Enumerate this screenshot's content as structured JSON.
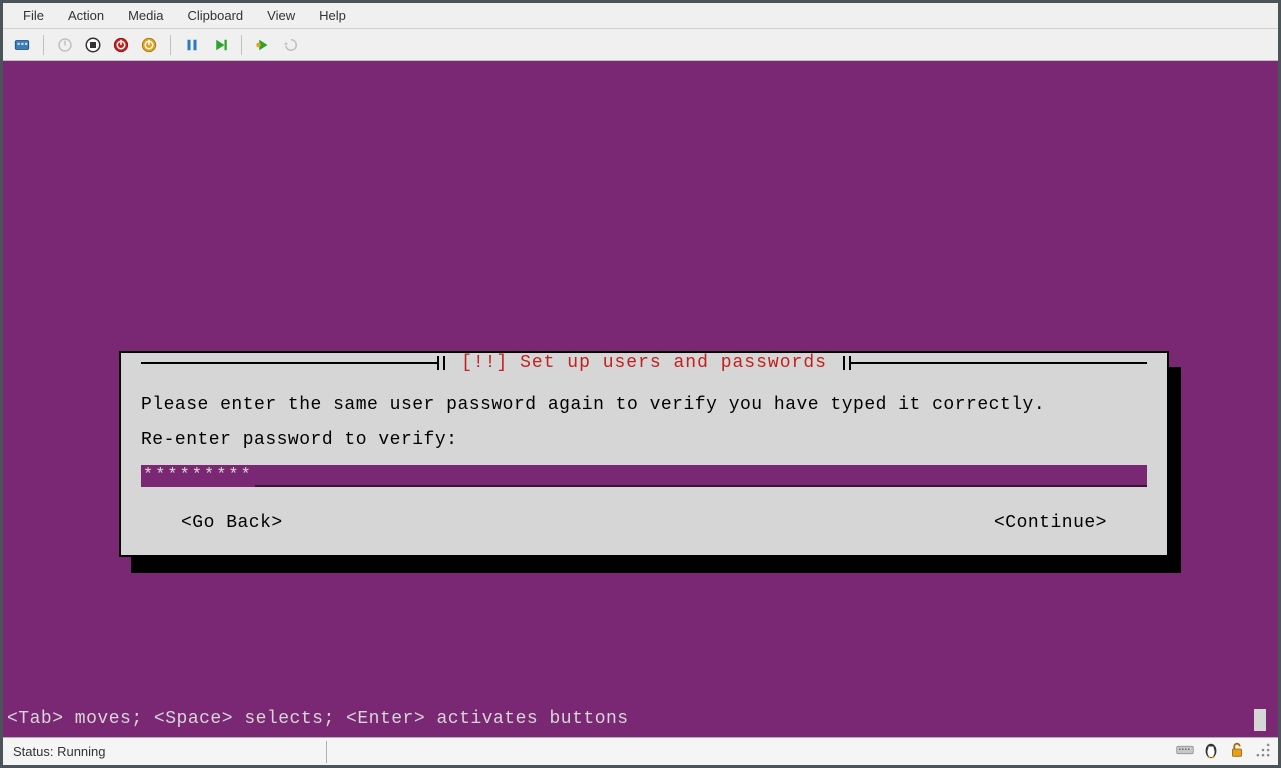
{
  "menu": {
    "file": "File",
    "action": "Action",
    "media": "Media",
    "clipboard": "Clipboard",
    "view": "View",
    "help": "Help"
  },
  "dialog": {
    "title": " [!!] Set up users and passwords ",
    "instruction": "Please enter the same user password again to verify you have typed it correctly.",
    "prompt": "Re-enter password to verify:",
    "password_masked": "*********",
    "go_back": "<Go Back>",
    "continue": "<Continue>"
  },
  "hint": "<Tab> moves; <Space> selects; <Enter> activates buttons",
  "status": {
    "label": "Status: Running"
  }
}
